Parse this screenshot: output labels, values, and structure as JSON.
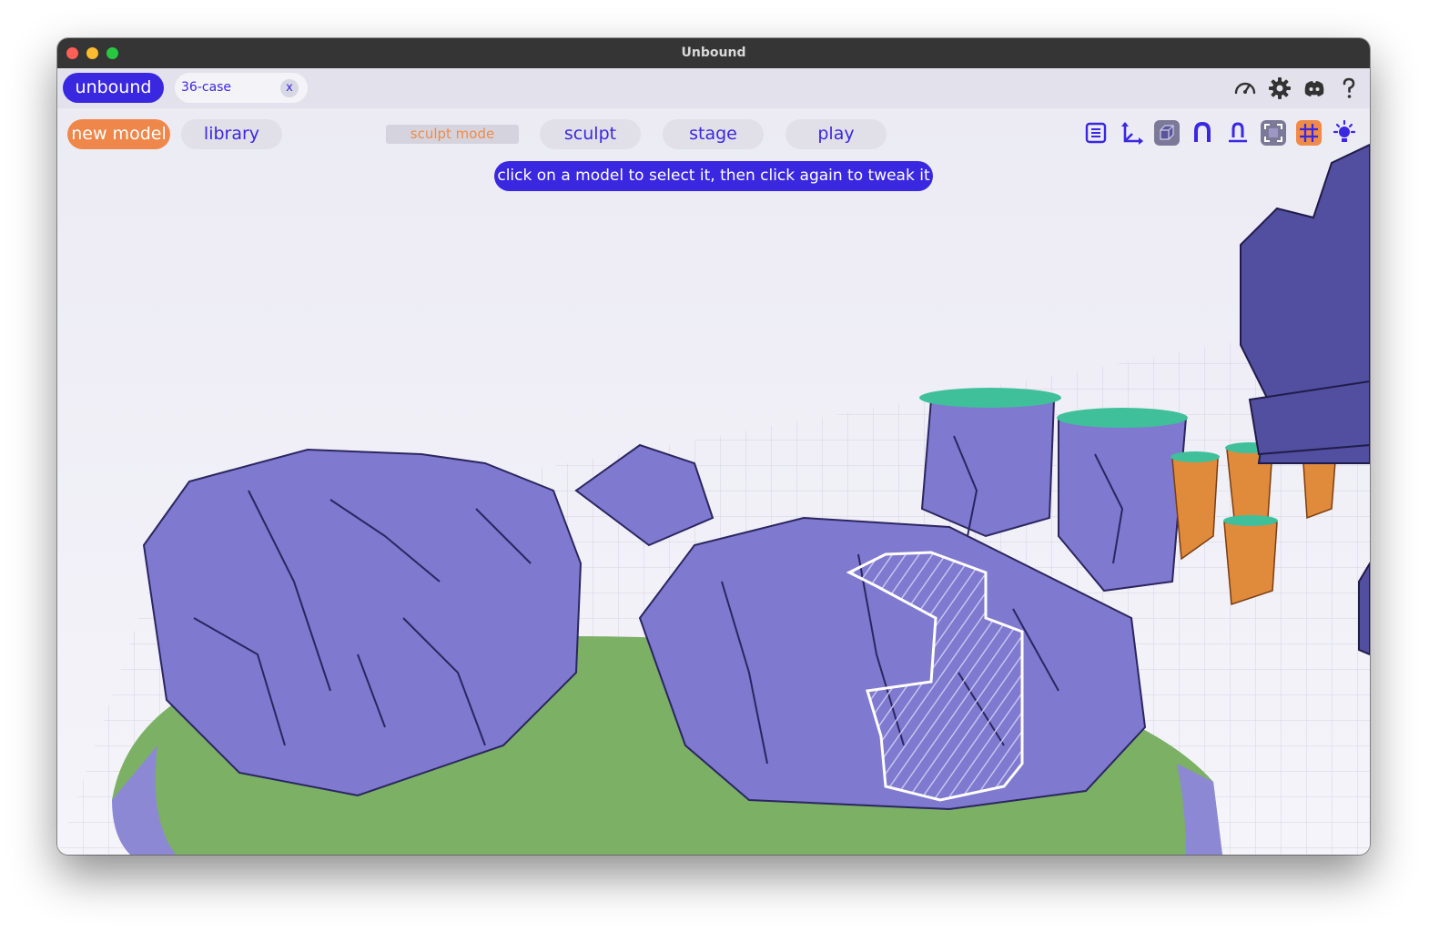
{
  "window": {
    "title": "Unbound"
  },
  "tabbar": {
    "app_tab": "unbound",
    "doc_tab": {
      "label": "36-case",
      "close": "x"
    },
    "icons": [
      "performance-gauge-icon",
      "gear-icon",
      "discord-icon",
      "help-icon"
    ]
  },
  "toolbar": {
    "new_model": "new model",
    "library": "library",
    "mode_label": "sculpt mode",
    "modes": [
      "sculpt",
      "stage",
      "play"
    ],
    "tools": [
      "layers-list-icon",
      "axes-gizmo-icon",
      "box-shading-icon",
      "magnet-snap-icon",
      "pin-anchor-icon",
      "frame-focus-icon",
      "grid-toggle-icon",
      "lighting-sun-icon"
    ]
  },
  "hint": "click on a model to select it, then click again to tweak it",
  "colors": {
    "accent": "#3a27e0",
    "new_model": "#f0874a",
    "rock": "#7f79cf",
    "grass": "#7bb065",
    "teal_cap": "#3fc09a",
    "orange_pillar": "#e08a3c"
  }
}
